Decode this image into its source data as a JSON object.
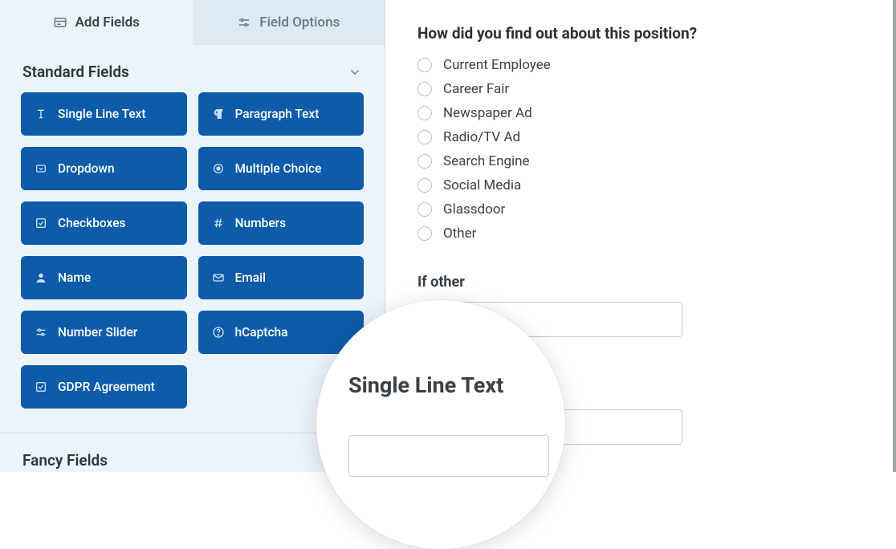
{
  "tabs": {
    "add_fields": "Add Fields",
    "field_options": "Field Options"
  },
  "sections": {
    "standard": "Standard Fields",
    "fancy": "Fancy Fields"
  },
  "fields": {
    "single_line_text": "Single Line Text",
    "paragraph_text": "Paragraph Text",
    "dropdown": "Dropdown",
    "multiple_choice": "Multiple Choice",
    "checkboxes": "Checkboxes",
    "numbers": "Numbers",
    "name": "Name",
    "email": "Email",
    "number_slider": "Number Slider",
    "hcaptcha": "hCaptcha",
    "gdpr": "GDPR Agreement"
  },
  "preview": {
    "question": "How did you find out about this position?",
    "options": [
      "Current Employee",
      "Career Fair",
      "Newspaper Ad",
      "Radio/TV Ad",
      "Search Engine",
      "Social Media",
      "Glassdoor",
      "Other"
    ],
    "if_other_label": "If other"
  },
  "lens": {
    "title": "Single Line Text"
  }
}
